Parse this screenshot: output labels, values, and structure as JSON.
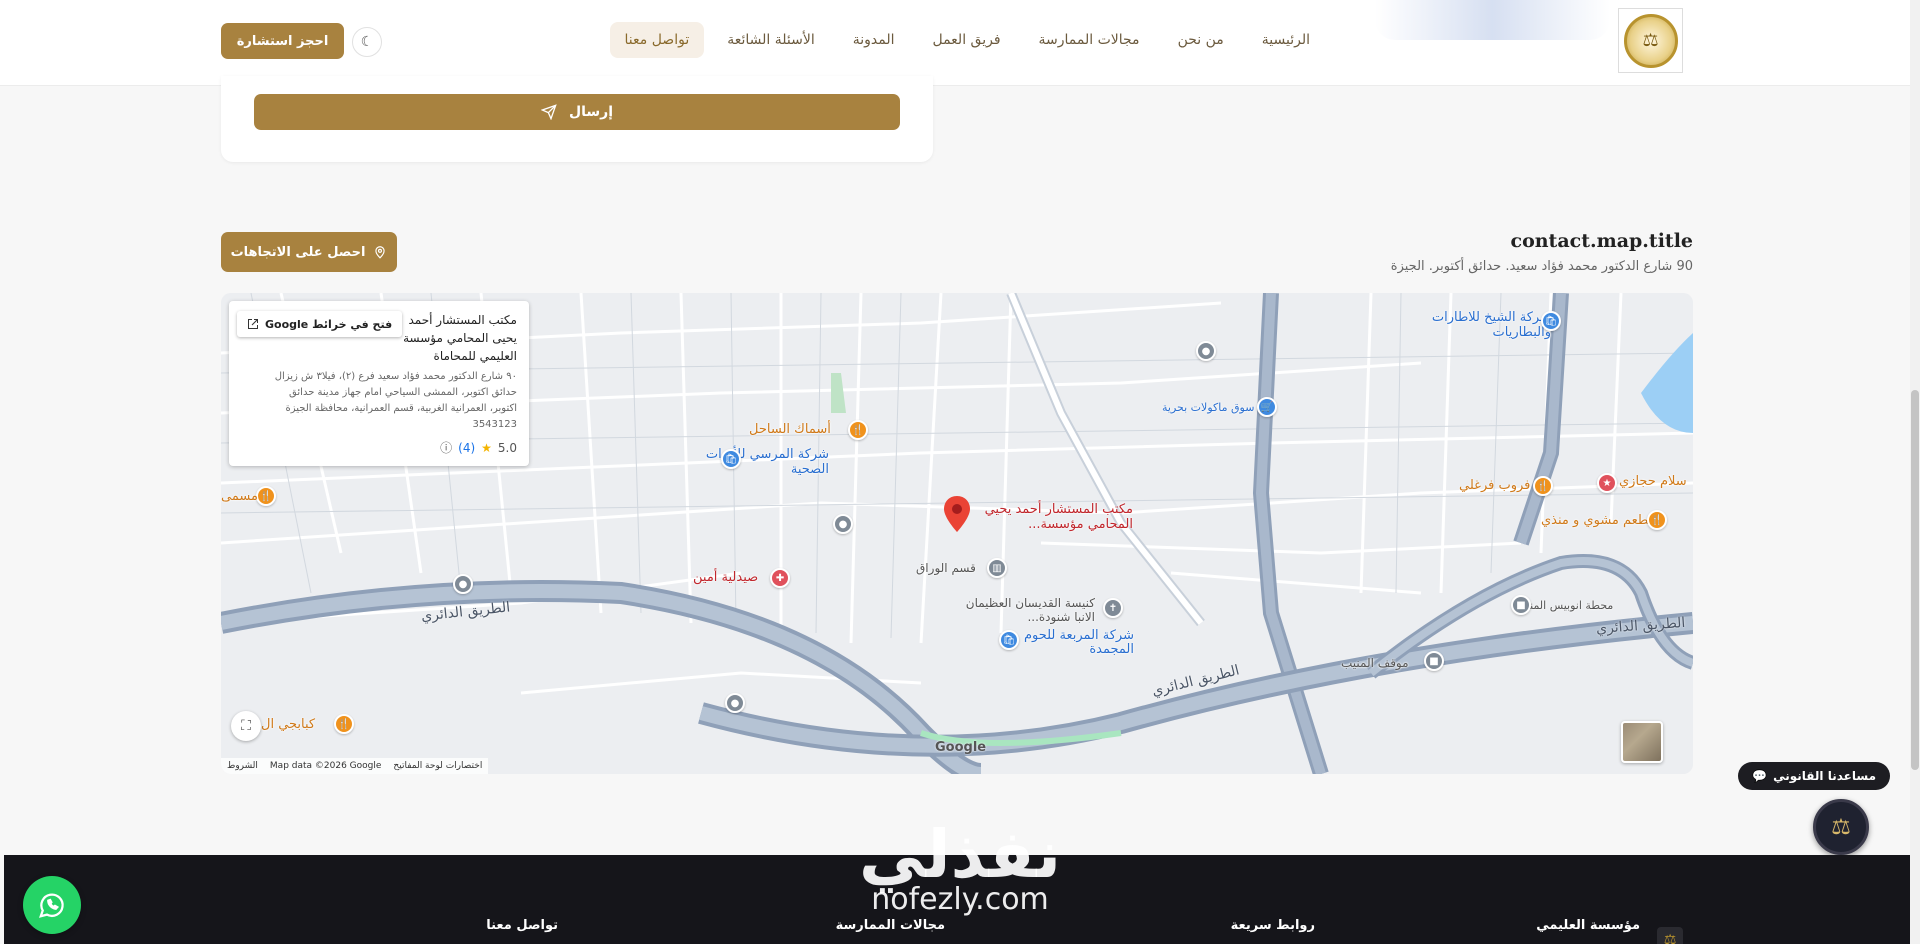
{
  "header": {
    "nav": [
      {
        "label": "الرئيسية",
        "active": false
      },
      {
        "label": "من نحن",
        "active": false
      },
      {
        "label": "مجالات الممارسة",
        "active": false
      },
      {
        "label": "فريق العمل",
        "active": false
      },
      {
        "label": "المدونة",
        "active": false
      },
      {
        "label": "الأسئلة الشائعة",
        "active": false
      },
      {
        "label": "تواصل معنا",
        "active": true
      }
    ],
    "consult_button": "احجز استشارة",
    "theme_icon": "moon-icon"
  },
  "form": {
    "send_button": "إرسال"
  },
  "map_section": {
    "title": "contact.map.title",
    "address": "90 شارع الدكتور محمد فؤاد سعيد. حدائق أكتوبر. الجيزة",
    "directions_button": "احصل على الاتجاهات"
  },
  "map": {
    "info_card": {
      "name": "مكتب المستشار أحمد يحيى المحامي مؤسسة العليمي للمحاماة",
      "address": "٩٠ شارع الدكتور محمد فؤاد سعيد فرع (٢)، فيلا٣ ش زيزال حدائق اكتوبر، الممشى السياحي امام جهاز مدينة حدائق اكتوبر، العمرانية الغربية، قسم العمرانية، محافظة الجيزة 3543123",
      "rating": "5.0",
      "reviews": "(4)",
      "open_button": "فتح في خرائط Google"
    },
    "labels": {
      "fish": "أسماك الساحل",
      "morsy": "شركة المرسي للأدوات الصحية",
      "sheikh": "شركة الشيخ للاطارات والبطاريات",
      "market": "سوق ماكولات بحرية",
      "office": "مكتب المستشار أحمد يحيي المحامي مؤسسة...",
      "pharmacy": "صيدلية أمين",
      "warraq": "قسم الوراق",
      "church": "كنيسة القديسان العظيمان الانبا شنودة...",
      "mor3": "شركة المربعة للحوم المجمدة",
      "ferghaly": "فروب فرغلي",
      "hegazy": "سلام حجازي",
      "mashwy": "مطعم مشوي و منذي",
      "kababgy": "كبابجي ال",
      "ring_road": "الطريق الدائري",
      "mosallas": "مسمى",
      "bus_stop": "موقف المنيب",
      "station": "محطة انوبيس المنيب"
    },
    "google": "Google",
    "footer": [
      "الشروط",
      "Map data ©2026 Google",
      "اختصارات لوحة المفاتيح"
    ]
  },
  "assistant": {
    "label": "مساعدنا القانوني"
  },
  "footer": {
    "brand": "مؤسسة العليمي",
    "quick_links": "روابط سريعة",
    "practice": "مجالات الممارسة",
    "contact": "تواصل معنا"
  },
  "watermark": {
    "ar": "نفذلي",
    "en": "nofezly.com"
  },
  "colors": {
    "accent": "#a8823f",
    "footer": "#15151a",
    "whatsapp": "#25d366"
  }
}
